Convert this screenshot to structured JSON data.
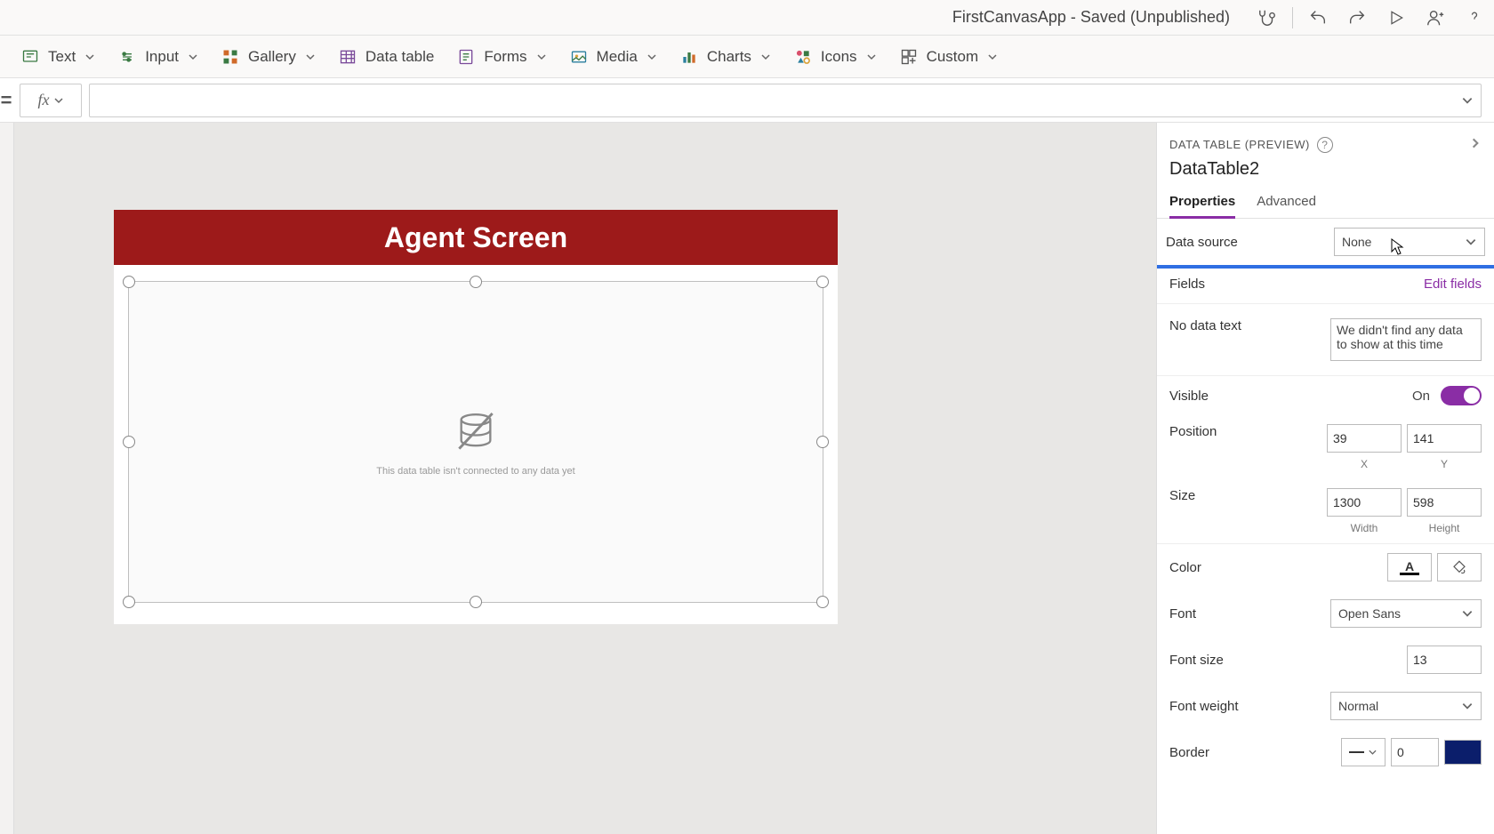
{
  "title": "FirstCanvasApp - Saved (Unpublished)",
  "ribbon": {
    "text": "Text",
    "input": "Input",
    "gallery": "Gallery",
    "data_table": "Data table",
    "forms": "Forms",
    "media": "Media",
    "charts": "Charts",
    "icons": "Icons",
    "custom": "Custom"
  },
  "formula": {
    "eq": "=",
    "fx": "fx",
    "value": ""
  },
  "canvas": {
    "screen_title": "Agent Screen",
    "empty_msg": "This data table isn't connected to any data yet"
  },
  "panel": {
    "type": "DATA TABLE (PREVIEW)",
    "name": "DataTable2",
    "tabs": {
      "properties": "Properties",
      "advanced": "Advanced"
    },
    "props": {
      "data_source_label": "Data source",
      "data_source_value": "None",
      "fields_label": "Fields",
      "edit_fields": "Edit fields",
      "no_data_label": "No data text",
      "no_data_value": "We didn't find any data to show at this time",
      "visible_label": "Visible",
      "visible_value": "On",
      "position_label": "Position",
      "x": "39",
      "y": "141",
      "x_lbl": "X",
      "y_lbl": "Y",
      "size_label": "Size",
      "w": "1300",
      "h": "598",
      "w_lbl": "Width",
      "h_lbl": "Height",
      "color_label": "Color",
      "font_label": "Font",
      "font_value": "Open Sans",
      "font_size_label": "Font size",
      "font_size_value": "13",
      "font_weight_label": "Font weight",
      "font_weight_value": "Normal",
      "border_label": "Border",
      "border_width": "0",
      "border_color": "#0b1e6b"
    }
  }
}
